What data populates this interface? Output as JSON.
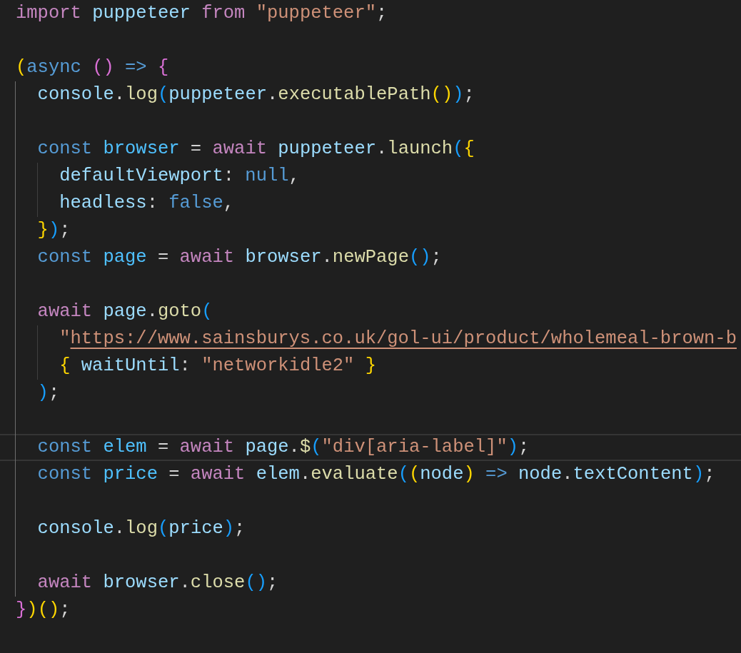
{
  "editor": {
    "lines": [
      {
        "current": false,
        "tokens": [
          {
            "text": "import ",
            "kind": "kw"
          },
          {
            "text": "puppeteer ",
            "kind": "var"
          },
          {
            "text": "from ",
            "kind": "kw"
          },
          {
            "text": "\"puppeteer\"",
            "kind": "str"
          },
          {
            "text": ";",
            "kind": "punct"
          }
        ]
      },
      {
        "current": false
      },
      {
        "current": false,
        "tokens": [
          {
            "text": "(",
            "kind": "b1"
          },
          {
            "text": "async ",
            "kind": "storage"
          },
          {
            "text": "() ",
            "kind": "b2"
          },
          {
            "text": "=> ",
            "kind": "storage"
          },
          {
            "text": "{",
            "kind": "b2"
          }
        ]
      },
      {
        "current": false,
        "tokens": [
          {
            "text": "  console",
            "kind": "var"
          },
          {
            "text": ".",
            "kind": "punct"
          },
          {
            "text": "log",
            "kind": "fn"
          },
          {
            "text": "(",
            "kind": "b3"
          },
          {
            "text": "puppeteer",
            "kind": "var"
          },
          {
            "text": ".",
            "kind": "punct"
          },
          {
            "text": "executablePath",
            "kind": "fn"
          },
          {
            "text": "()",
            "kind": "b1"
          },
          {
            "text": ")",
            "kind": "b3"
          },
          {
            "text": ";",
            "kind": "punct"
          }
        ]
      },
      {
        "current": false
      },
      {
        "current": false,
        "tokens": [
          {
            "text": "  const ",
            "kind": "storage"
          },
          {
            "text": "browser",
            "kind": "const"
          },
          {
            "text": " = ",
            "kind": "punct"
          },
          {
            "text": "await ",
            "kind": "kw"
          },
          {
            "text": "puppeteer",
            "kind": "var"
          },
          {
            "text": ".",
            "kind": "punct"
          },
          {
            "text": "launch",
            "kind": "fn"
          },
          {
            "text": "(",
            "kind": "b3"
          },
          {
            "text": "{",
            "kind": "b1"
          }
        ]
      },
      {
        "current": false,
        "tokens": [
          {
            "text": "    defaultViewport",
            "kind": "var"
          },
          {
            "text": ": ",
            "kind": "punct"
          },
          {
            "text": "null",
            "kind": "storage"
          },
          {
            "text": ",",
            "kind": "punct"
          }
        ]
      },
      {
        "current": false,
        "tokens": [
          {
            "text": "    headless",
            "kind": "var"
          },
          {
            "text": ": ",
            "kind": "punct"
          },
          {
            "text": "false",
            "kind": "storage"
          },
          {
            "text": ",",
            "kind": "punct"
          }
        ]
      },
      {
        "current": false,
        "tokens": [
          {
            "text": "  }",
            "kind": "b1"
          },
          {
            "text": ")",
            "kind": "b3"
          },
          {
            "text": ";",
            "kind": "punct"
          }
        ]
      },
      {
        "current": false,
        "tokens": [
          {
            "text": "  const ",
            "kind": "storage"
          },
          {
            "text": "page",
            "kind": "const"
          },
          {
            "text": " = ",
            "kind": "punct"
          },
          {
            "text": "await ",
            "kind": "kw"
          },
          {
            "text": "browser",
            "kind": "var"
          },
          {
            "text": ".",
            "kind": "punct"
          },
          {
            "text": "newPage",
            "kind": "fn"
          },
          {
            "text": "()",
            "kind": "b3"
          },
          {
            "text": ";",
            "kind": "punct"
          }
        ]
      },
      {
        "current": false
      },
      {
        "current": false,
        "tokens": [
          {
            "text": "  await ",
            "kind": "kw"
          },
          {
            "text": "page",
            "kind": "var"
          },
          {
            "text": ".",
            "kind": "punct"
          },
          {
            "text": "goto",
            "kind": "fn"
          },
          {
            "text": "(",
            "kind": "b3"
          }
        ]
      },
      {
        "current": false,
        "tokens": [
          {
            "text": "    \"",
            "kind": "str"
          },
          {
            "text": "https://www.sainsburys.co.uk/gol-ui/product/wholemeal-brown-b",
            "kind": "link"
          }
        ]
      },
      {
        "current": false,
        "tokens": [
          {
            "text": "    {",
            "kind": "b1"
          },
          {
            "text": " waitUntil",
            "kind": "var"
          },
          {
            "text": ": ",
            "kind": "punct"
          },
          {
            "text": "\"networkidle2\" ",
            "kind": "str"
          },
          {
            "text": "}",
            "kind": "b1"
          }
        ]
      },
      {
        "current": false,
        "tokens": [
          {
            "text": "  )",
            "kind": "b3"
          },
          {
            "text": ";",
            "kind": "punct"
          }
        ]
      },
      {
        "current": false
      },
      {
        "current": true,
        "tokens": [
          {
            "text": "  const ",
            "kind": "storage"
          },
          {
            "text": "elem",
            "kind": "const"
          },
          {
            "text": " = ",
            "kind": "punct"
          },
          {
            "text": "await ",
            "kind": "kw"
          },
          {
            "text": "page",
            "kind": "var"
          },
          {
            "text": ".",
            "kind": "punct"
          },
          {
            "text": "$",
            "kind": "fn"
          },
          {
            "text": "(",
            "kind": "b3"
          },
          {
            "text": "\"div[aria-label]\"",
            "kind": "str"
          },
          {
            "text": ")",
            "kind": "b3"
          },
          {
            "text": ";",
            "kind": "punct"
          }
        ]
      },
      {
        "current": false,
        "tokens": [
          {
            "text": "  const ",
            "kind": "storage"
          },
          {
            "text": "price",
            "kind": "const"
          },
          {
            "text": " = ",
            "kind": "punct"
          },
          {
            "text": "await ",
            "kind": "kw"
          },
          {
            "text": "elem",
            "kind": "var"
          },
          {
            "text": ".",
            "kind": "punct"
          },
          {
            "text": "evaluate",
            "kind": "fn"
          },
          {
            "text": "(",
            "kind": "b3"
          },
          {
            "text": "(",
            "kind": "b1"
          },
          {
            "text": "node",
            "kind": "var"
          },
          {
            "text": ") ",
            "kind": "b1"
          },
          {
            "text": "=> ",
            "kind": "storage"
          },
          {
            "text": "node",
            "kind": "var"
          },
          {
            "text": ".",
            "kind": "punct"
          },
          {
            "text": "textContent",
            "kind": "var"
          },
          {
            "text": ")",
            "kind": "b3"
          },
          {
            "text": ";",
            "kind": "punct"
          }
        ]
      },
      {
        "current": false
      },
      {
        "current": false,
        "tokens": [
          {
            "text": "  console",
            "kind": "var"
          },
          {
            "text": ".",
            "kind": "punct"
          },
          {
            "text": "log",
            "kind": "fn"
          },
          {
            "text": "(",
            "kind": "b3"
          },
          {
            "text": "price",
            "kind": "var"
          },
          {
            "text": ")",
            "kind": "b3"
          },
          {
            "text": ";",
            "kind": "punct"
          }
        ]
      },
      {
        "current": false
      },
      {
        "current": false,
        "tokens": [
          {
            "text": "  await ",
            "kind": "kw"
          },
          {
            "text": "browser",
            "kind": "var"
          },
          {
            "text": ".",
            "kind": "punct"
          },
          {
            "text": "close",
            "kind": "fn"
          },
          {
            "text": "()",
            "kind": "b3"
          },
          {
            "text": ";",
            "kind": "punct"
          }
        ]
      },
      {
        "current": false,
        "tokens": [
          {
            "text": "}",
            "kind": "b2"
          },
          {
            "text": ")",
            "kind": "b1"
          },
          {
            "text": "()",
            "kind": "b1"
          },
          {
            "text": ";",
            "kind": "punct"
          }
        ]
      }
    ]
  }
}
